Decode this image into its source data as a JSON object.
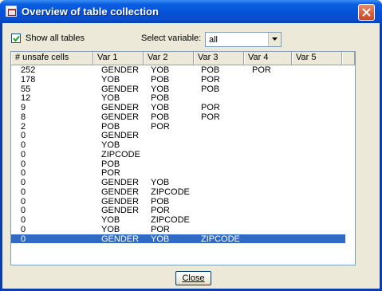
{
  "window": {
    "title": "Overview of table collection",
    "icon": "app-icon",
    "close_icon": "close-icon"
  },
  "options": {
    "show_all_tables_label": "Show all tables",
    "show_all_tables_checked": true,
    "select_variable_label": "Select variable:",
    "select_variable_value": "all"
  },
  "table": {
    "columns": [
      "# unsafe cells",
      "Var 1",
      "Var 2",
      "Var 3",
      "Var 4",
      "Var 5"
    ],
    "rows": [
      [
        "252",
        "GENDER",
        "YOB",
        "POB",
        "POR",
        ""
      ],
      [
        "178",
        "YOB",
        "POB",
        "POR",
        "",
        ""
      ],
      [
        "55",
        "GENDER",
        "YOB",
        "POB",
        "",
        ""
      ],
      [
        "12",
        "YOB",
        "POB",
        "",
        "",
        ""
      ],
      [
        "9",
        "GENDER",
        "YOB",
        "POR",
        "",
        ""
      ],
      [
        "8",
        "GENDER",
        "POB",
        "POR",
        "",
        ""
      ],
      [
        "2",
        "POB",
        "POR",
        "",
        "",
        ""
      ],
      [
        "0",
        "GENDER",
        "",
        "",
        "",
        ""
      ],
      [
        "0",
        "YOB",
        "",
        "",
        "",
        ""
      ],
      [
        "0",
        "ZIPCODE",
        "",
        "",
        "",
        ""
      ],
      [
        "0",
        "POB",
        "",
        "",
        "",
        ""
      ],
      [
        "0",
        "POR",
        "",
        "",
        "",
        ""
      ],
      [
        "0",
        "GENDER",
        "YOB",
        "",
        "",
        ""
      ],
      [
        "0",
        "GENDER",
        "ZIPCODE",
        "",
        "",
        ""
      ],
      [
        "0",
        "GENDER",
        "POB",
        "",
        "",
        ""
      ],
      [
        "0",
        "GENDER",
        "POR",
        "",
        "",
        ""
      ],
      [
        "0",
        "YOB",
        "ZIPCODE",
        "",
        "",
        ""
      ],
      [
        "0",
        "YOB",
        "POR",
        "",
        "",
        ""
      ],
      [
        "0",
        "GENDER",
        "YOB",
        "ZIPCODE",
        "",
        ""
      ]
    ],
    "selected_row": 18
  },
  "buttons": {
    "close_label": "Close"
  },
  "colors": {
    "titlebar": "#0553d8",
    "selection": "#316ac5",
    "dialog_bg": "#ece9d8"
  }
}
